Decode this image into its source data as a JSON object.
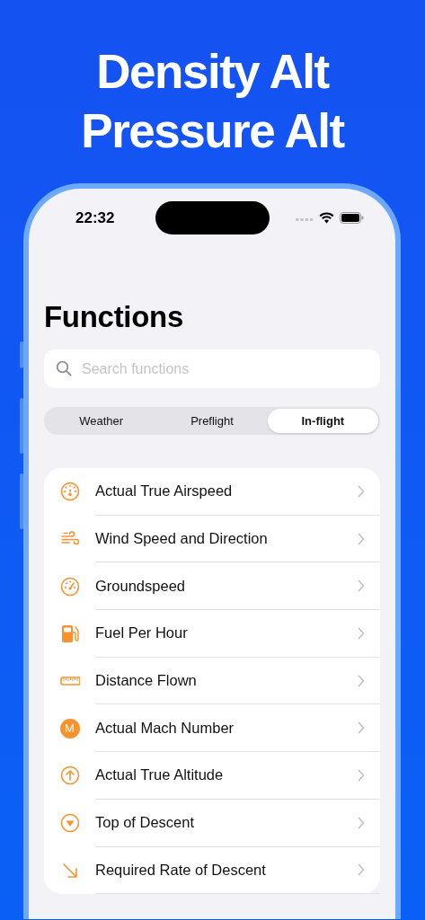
{
  "headline": [
    "Density Alt",
    "Pressure Alt"
  ],
  "status_bar": {
    "time": "22:32"
  },
  "title": "Functions",
  "search": {
    "placeholder": "Search functions"
  },
  "tabs": [
    {
      "label": "Weather",
      "selected": false
    },
    {
      "label": "Preflight",
      "selected": false
    },
    {
      "label": "In-flight",
      "selected": true
    }
  ],
  "functions": [
    {
      "label": "Actual True Airspeed"
    },
    {
      "label": "Wind Speed and Direction"
    },
    {
      "label": "Groundspeed"
    },
    {
      "label": "Fuel Per Hour"
    },
    {
      "label": "Distance Flown"
    },
    {
      "label": "Actual Mach Number",
      "badge": "M"
    },
    {
      "label": "Actual True Altitude"
    },
    {
      "label": "Top of Descent"
    },
    {
      "label": "Required Rate of Descent"
    }
  ]
}
